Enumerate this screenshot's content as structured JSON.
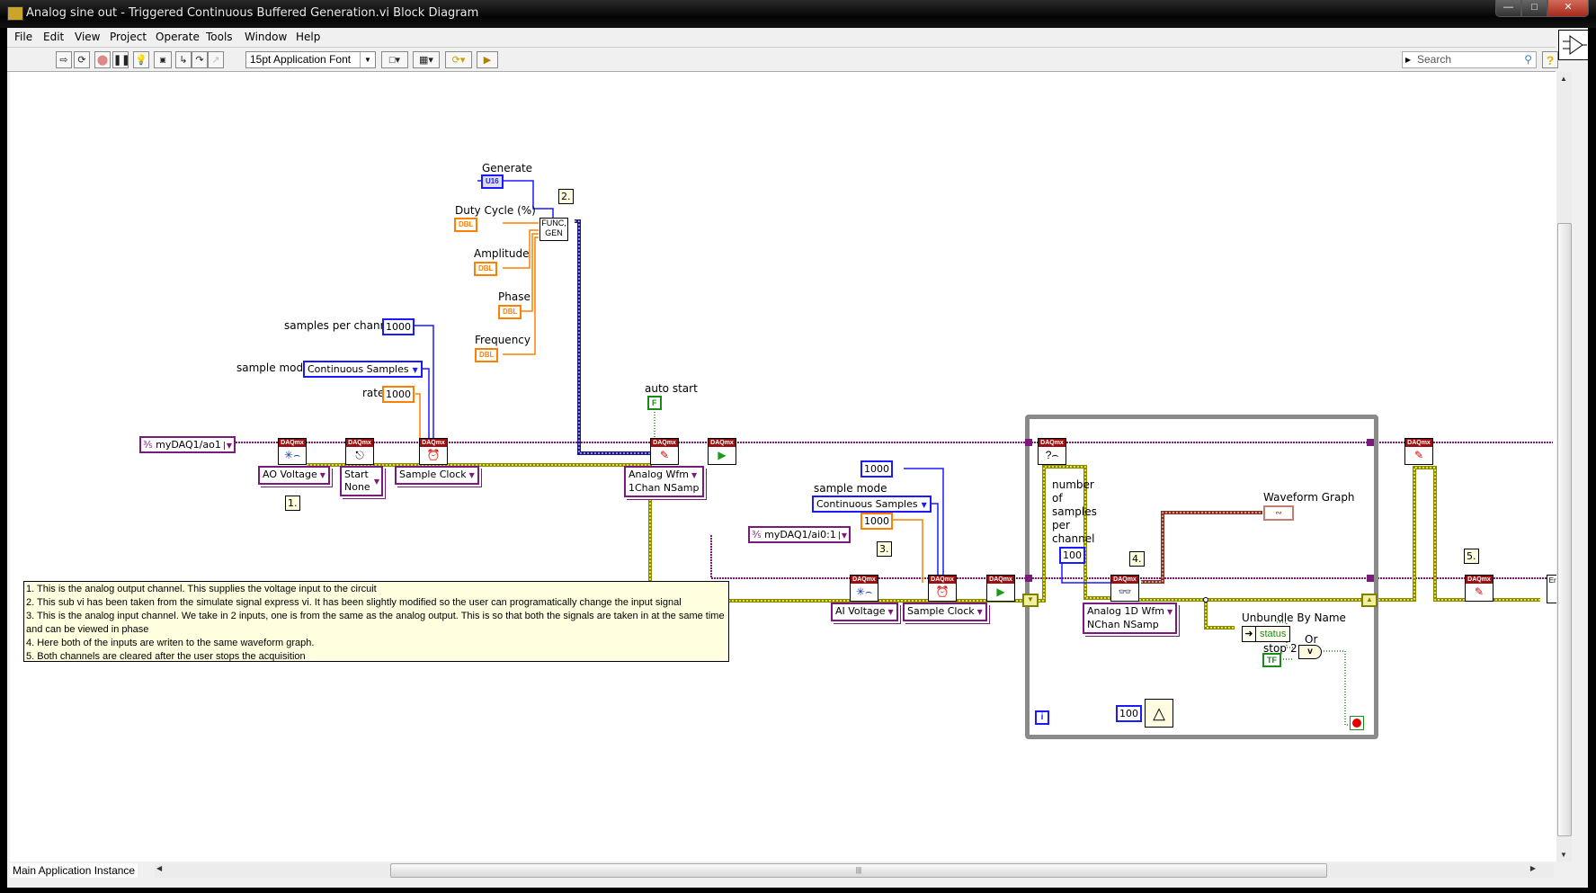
{
  "window": {
    "title": "Analog sine out  -  Triggered Continuous Buffered Generation.vi Block Diagram",
    "controls": [
      "minimize",
      "maximize",
      "close"
    ]
  },
  "menu": [
    "File",
    "Edit",
    "View",
    "Project",
    "Operate",
    "Tools",
    "Window",
    "Help"
  ],
  "toolbar": {
    "buttons": [
      "run-arrow",
      "run-continuously",
      "abort",
      "pause",
      "highlight-execution",
      "retain-wire-values",
      "step-into",
      "step-over",
      "step-out",
      "align-objects",
      "distribute-objects",
      "reorder",
      "clean-up-diagram"
    ],
    "font": "15pt Application Font",
    "search_placeholder": "Search",
    "help": "?"
  },
  "diagram": {
    "ao_channel": "myDAQ1/ao1",
    "ao_chan_type": "AO Voltage",
    "trigger": [
      "Start",
      "None"
    ],
    "timing_type": "Sample Clock",
    "samples_per_channel_label": "samples per channel",
    "samples_per_channel": "1000",
    "sample_mode_label": "sample mode",
    "sample_mode": "Continuous Samples",
    "rate_label": "rate",
    "rate": "1000",
    "funcgen": {
      "generate_label": "Generate",
      "generate_type": "U16",
      "duty_label": "Duty Cycle (%)",
      "amplitude_label": "Amplitude",
      "phase_label": "Phase",
      "frequency_label": "Frequency",
      "dbl": "DBL",
      "subvi": "FUNC, GEN"
    },
    "auto_start_label": "auto start",
    "auto_start_value": "F",
    "write_type": [
      "Analog Wfm",
      "1Chan NSamp"
    ],
    "ai_channel": "myDAQ1/ai0:1",
    "ai_chan_type": "AI Voltage",
    "ai_samples": "1000",
    "ai_sample_mode_label": "sample mode",
    "ai_sample_mode": "Continuous Samples",
    "ai_rate": "1000",
    "loop": {
      "num_samples_label": [
        "number",
        "of",
        "samples",
        "per",
        "channel"
      ],
      "num_samples": "100",
      "read_type": [
        "Analog 1D Wfm",
        "NChan NSamp"
      ],
      "waveform_graph_label": "Waveform Graph",
      "unbundle_label": "Unbundle By Name",
      "unbundle_field": "status",
      "stop_label": "stop",
      "stop_value": "TF",
      "or_label": "Or",
      "or_symbol": "v",
      "two": "2",
      "wait_ms": "100",
      "iteration": "i"
    },
    "daqmx_header": "DAQmx",
    "error_handler": "Error ?!",
    "notes": [
      "1.",
      "2.",
      "3.",
      "4.",
      "5."
    ],
    "comment": [
      "1. This is the analog output channel. This supplies the voltage input to the circuit",
      "2. This sub vi has been taken from the simulate signal express vi. It has been slightly modified so the user can programatically change the input signal",
      "3. This is the analog input channel. We take in 2 inputs, one is from the same as the analog output. This is so that both the signals are taken in at the same time and can be viewed in phase",
      "4. Here both of the inputs are writen to the same waveform graph.",
      "5. Both channels are cleared after the user stops the acquisition"
    ]
  },
  "status": {
    "context": "Main Application Instance"
  },
  "colors": {
    "task_wire": "#7a1a7a",
    "error_wire": "#c8c800",
    "int_wire": "#1a1aff",
    "dbl_wire": "#ff8000",
    "bool_wire": "#1a8a1a",
    "daqmx_header": "#9a1010"
  }
}
